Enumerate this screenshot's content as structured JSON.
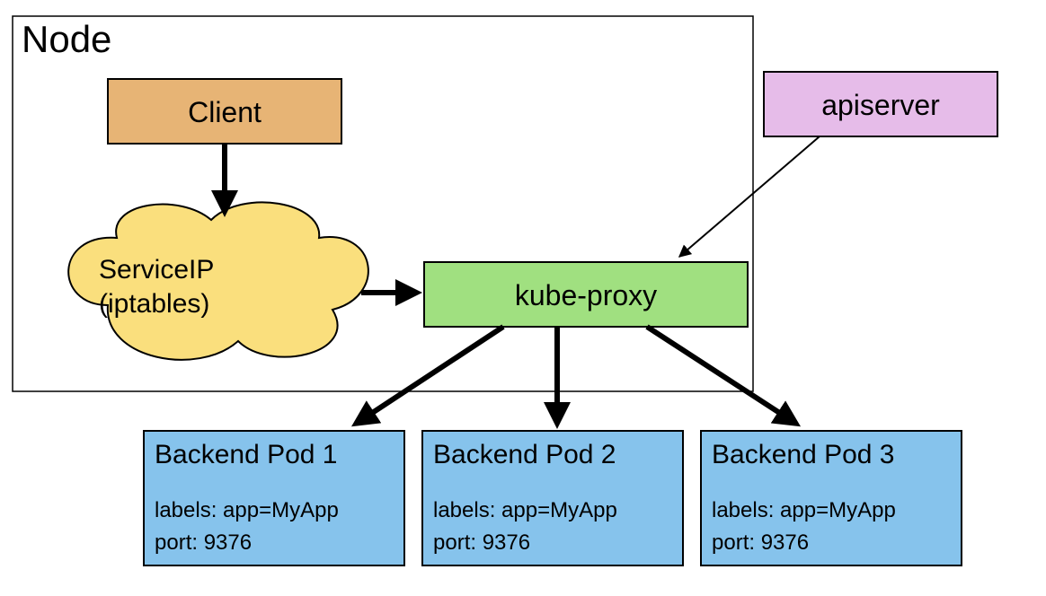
{
  "diagram": {
    "node_title": "Node",
    "client_label": "Client",
    "apiserver_label": "apiserver",
    "serviceip_line1": "ServiceIP",
    "serviceip_line2": "(iptables)",
    "kubeproxy_label": "kube-proxy",
    "pods": [
      {
        "title": "Backend Pod 1",
        "labels": "labels: app=MyApp",
        "port": "port: 9376"
      },
      {
        "title": "Backend Pod 2",
        "labels": "labels: app=MyApp",
        "port": "port: 9376"
      },
      {
        "title": "Backend Pod 3",
        "labels": "labels: app=MyApp",
        "port": "port: 9376"
      }
    ],
    "colors": {
      "client_fill": "#e7b475",
      "apiserver_fill": "#e6bce9",
      "serviceip_fill": "#fadf7d",
      "kubeproxy_fill": "#a0e080",
      "pod_fill": "#86c3ec",
      "stroke": "#000000"
    }
  }
}
